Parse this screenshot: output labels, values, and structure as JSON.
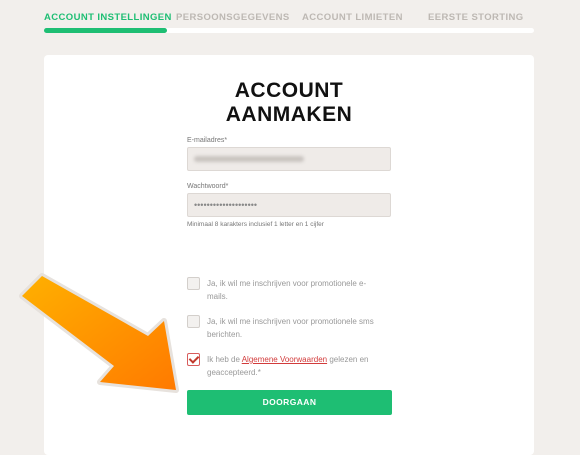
{
  "steps": [
    {
      "label": "ACCOUNT INSTELLINGEN",
      "active": true
    },
    {
      "label": "PERSOONSGEGEVENS",
      "active": false
    },
    {
      "label": "ACCOUNT LIMIETEN",
      "active": false
    },
    {
      "label": "EERSTE STORTING",
      "active": false
    }
  ],
  "progress": 0.25,
  "form": {
    "title_line1": "ACCOUNT",
    "title_line2": "AANMAKEN",
    "email_label": "E-mailadres*",
    "password_label": "Wachtwoord*",
    "password_value": "••••••••••••••••••••",
    "password_hint": "Minimaal 8 karakters inclusief 1 letter en 1 cijfer"
  },
  "checkboxes": [
    {
      "text": "Ja, ik wil me inschrijven voor promotionele e-mails.",
      "checked": false
    },
    {
      "text": "Ja, ik wil me inschrijven voor promotionele sms berichten.",
      "checked": false
    },
    {
      "text_before": "Ik heb de ",
      "link_text": "Algemene Voorwaarden",
      "text_after": " gelezen en geaccepteerd.*",
      "checked": true
    }
  ],
  "submit_label": "DOORGAAN",
  "colors": {
    "accent": "#1ebe73",
    "link": "#d23b3b",
    "arrow": "#ff8a00"
  },
  "icons": {
    "pointer": "arrow-icon"
  }
}
